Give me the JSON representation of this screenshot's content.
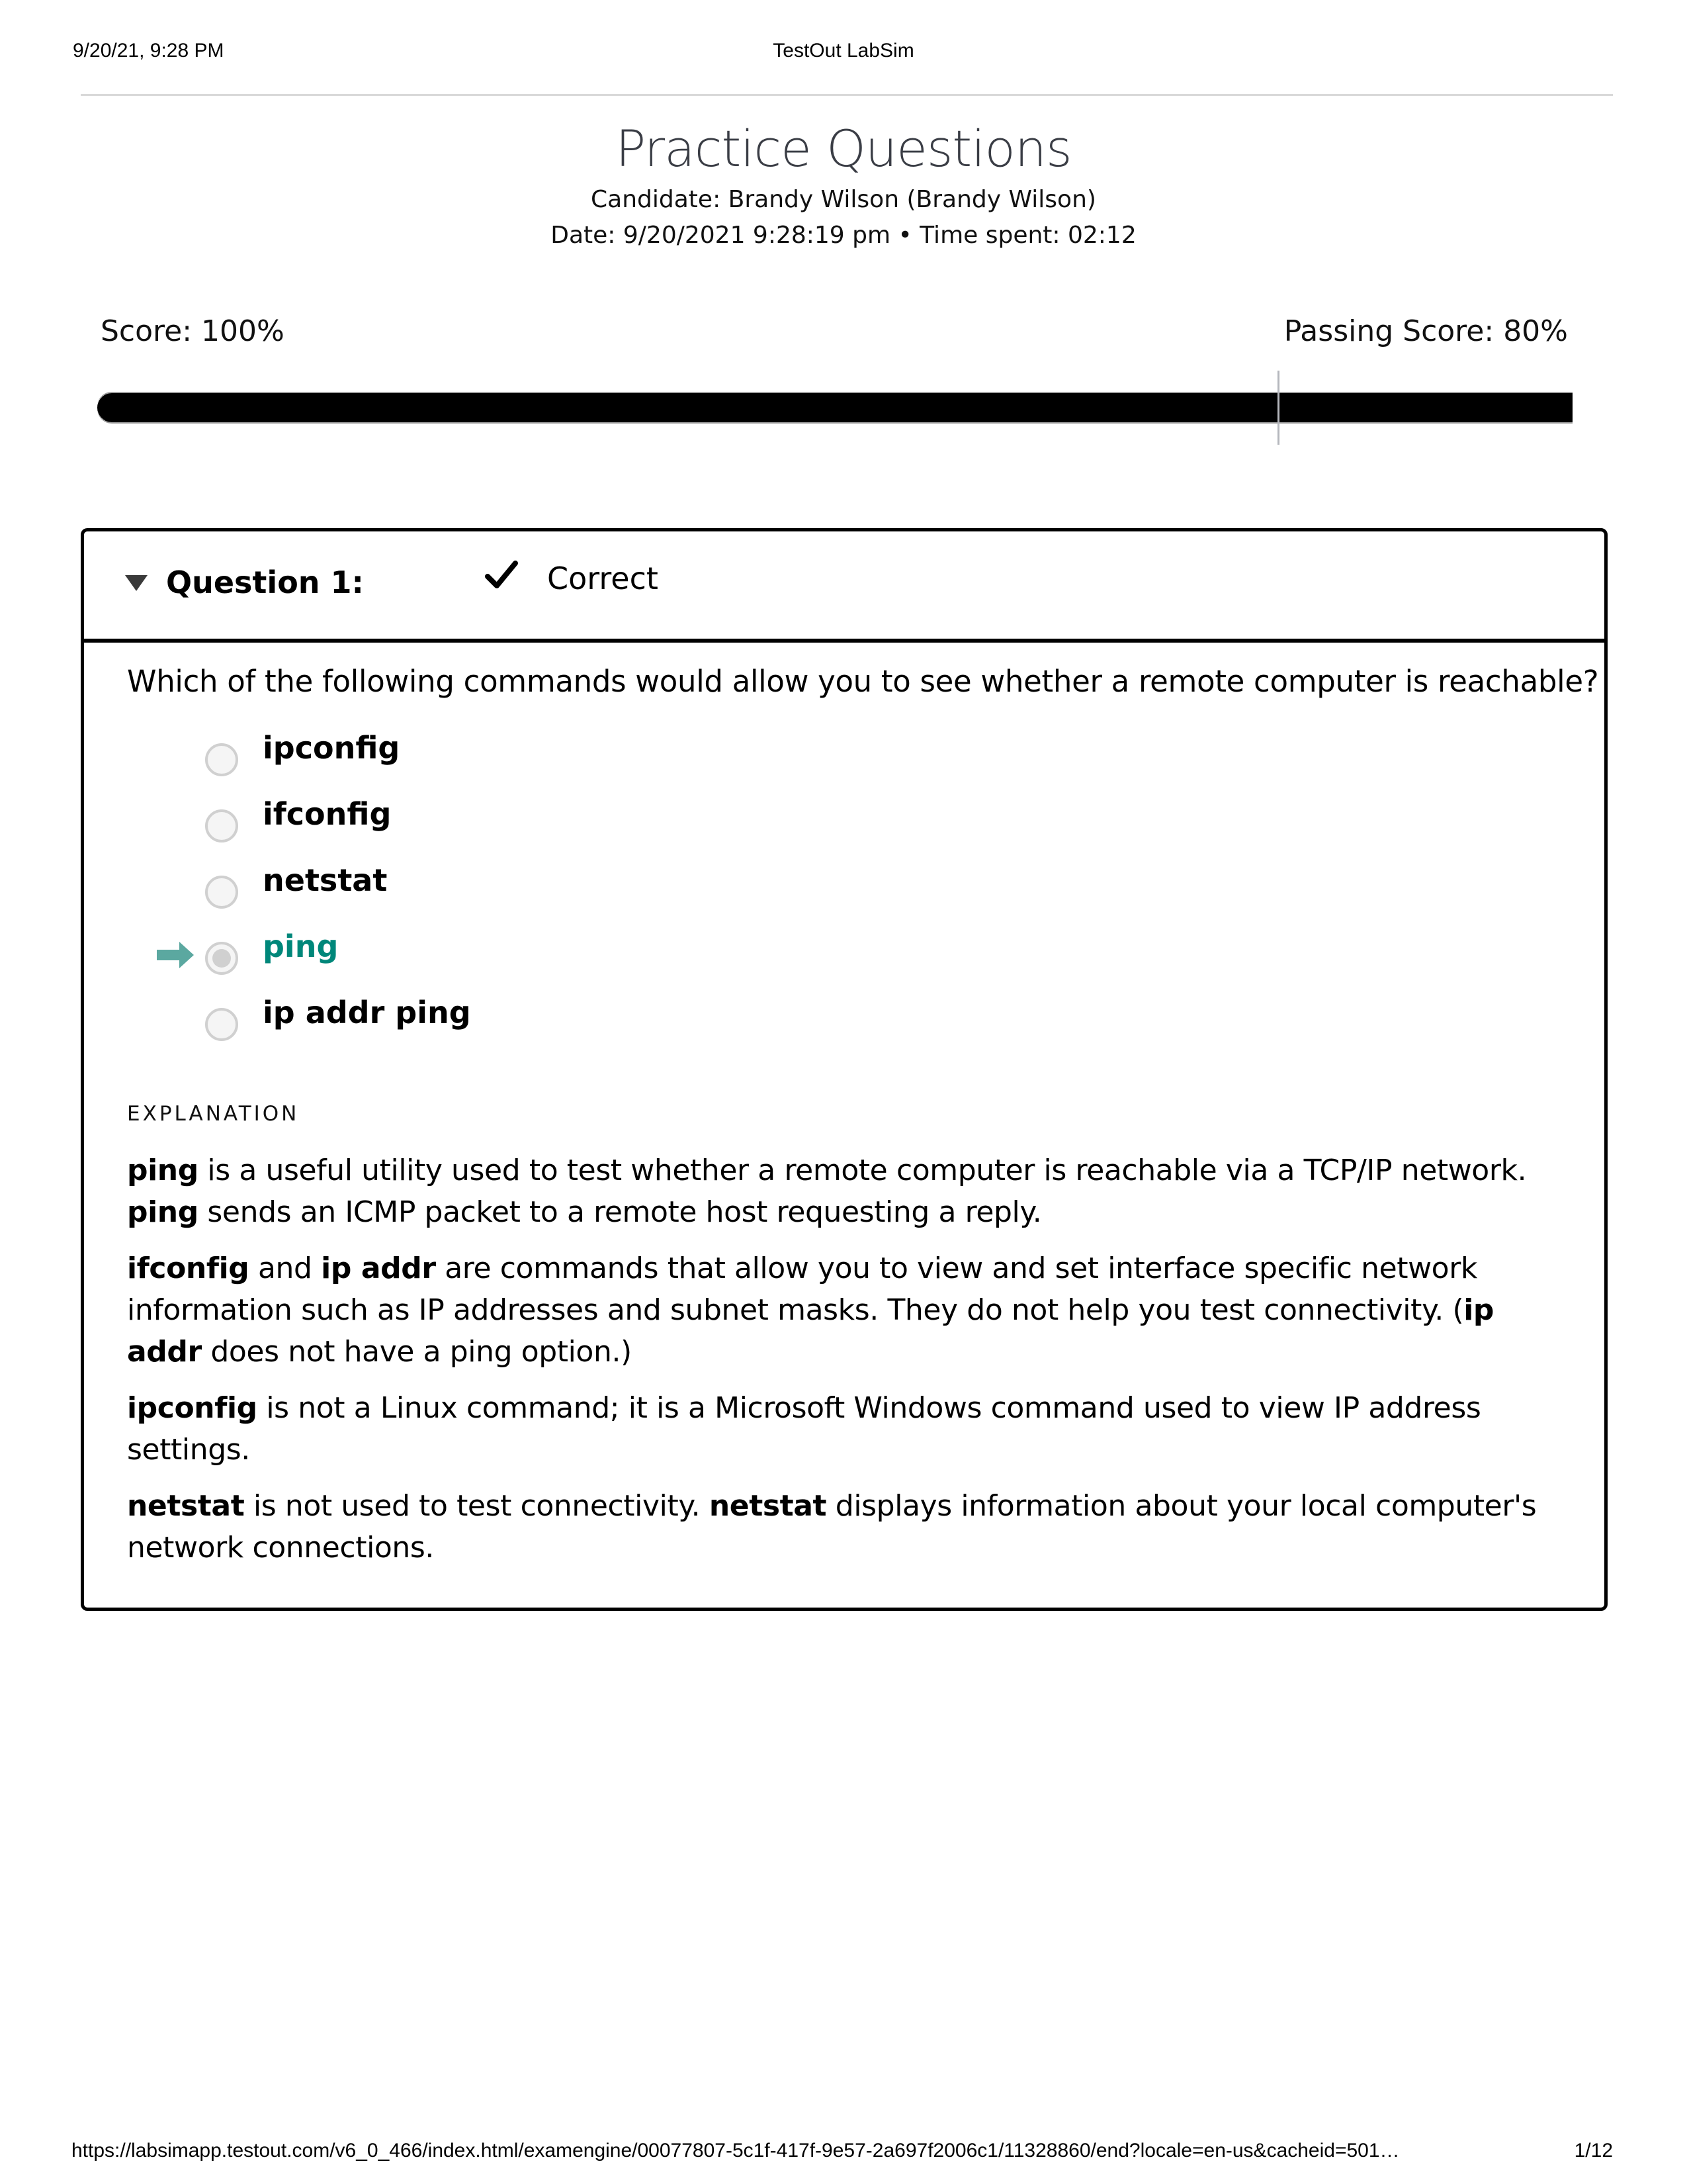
{
  "print_header": {
    "datetime": "9/20/21, 9:28 PM",
    "title": "TestOut LabSim"
  },
  "page": {
    "title": "Practice Questions",
    "candidate": "Candidate: Brandy Wilson  (Brandy Wilson)",
    "date_line": "Date: 9/20/2021 9:28:19 pm • Time spent: 02:12"
  },
  "score": {
    "score_label": "Score: 100%",
    "passing_label": "Passing Score: 80%",
    "score_percent": 100,
    "passing_percent": 80
  },
  "question": {
    "number_label": "Question 1:",
    "status": "Correct",
    "status_icon": "check-icon",
    "text": "Which of the following commands would allow you to see whether a remote computer is reachable?",
    "options": [
      {
        "label": "ipconfig",
        "selected": false,
        "correct": false
      },
      {
        "label": "ifconfig",
        "selected": false,
        "correct": false
      },
      {
        "label": "netstat",
        "selected": false,
        "correct": false
      },
      {
        "label": "ping",
        "selected": true,
        "correct": true
      },
      {
        "label": "ip addr ping",
        "selected": false,
        "correct": false
      }
    ],
    "correct_color": "#00877a",
    "arrow_color": "#5ba8a0"
  },
  "explanation": {
    "title": "EXPLANATION",
    "paragraphs": [
      [
        {
          "b": "ping"
        },
        {
          "t": " is a useful utility used to test whether a remote computer is reachable via a TCP/IP network. "
        },
        {
          "b": "ping"
        },
        {
          "t": " sends an ICMP packet to a remote host requesting a reply."
        }
      ],
      [
        {
          "b": "ifconfig"
        },
        {
          "t": " and "
        },
        {
          "b": "ip addr"
        },
        {
          "t": " are commands that allow you to view and set interface specific network information such as IP addresses and subnet masks. They do not help you test connectivity. ("
        },
        {
          "b": "ip addr"
        },
        {
          "t": " does not have a ping option.)"
        }
      ],
      [
        {
          "b": "ipconfig"
        },
        {
          "t": " is not a Linux command; it is a Microsoft Windows command used to view IP address settings."
        }
      ],
      [
        {
          "b": "netstat"
        },
        {
          "t": " is not used to test connectivity. "
        },
        {
          "b": "netstat"
        },
        {
          "t": " displays information about your local computer's network connections."
        }
      ]
    ]
  },
  "print_footer": {
    "url": "https://labsimapp.testout.com/v6_0_466/index.html/examengine/00077807-5c1f-417f-9e57-2a697f2006c1/11328860/end?locale=en-us&cacheid=501…",
    "page": "1/12"
  }
}
